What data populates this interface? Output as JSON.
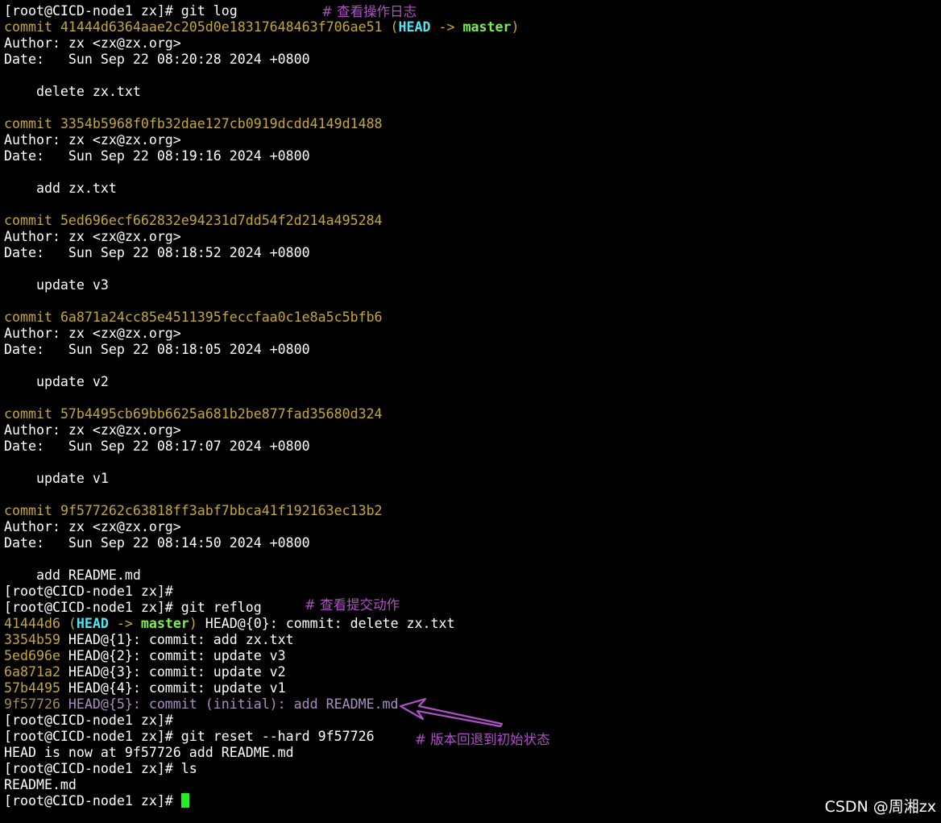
{
  "prompt": "[root@CICD-node1 zx]# ",
  "annotations": {
    "git_log": "# 查看操作日志",
    "git_reflog": "# 查看提交动作",
    "reset": "# 版本回退到初始状态"
  },
  "log": {
    "command": "git log",
    "commits": [
      {
        "word": "commit ",
        "hash": "41444d6364aae2c205d0e18317648463f706ae51",
        "author": "Author: zx <zx@zx.org>",
        "date": "Date:   Sun Sep 22 08:20:28 2024 +0800",
        "message": "    delete zx.txt"
      },
      {
        "word": "commit ",
        "hash": "3354b5968f0fb32dae127cb0919dcdd4149d1488",
        "author": "Author: zx <zx@zx.org>",
        "date": "Date:   Sun Sep 22 08:19:16 2024 +0800",
        "message": "    add zx.txt"
      },
      {
        "word": "commit ",
        "hash": "5ed696ecf662832e94231d7dd54f2d214a495284",
        "author": "Author: zx <zx@zx.org>",
        "date": "Date:   Sun Sep 22 08:18:52 2024 +0800",
        "message": "    update v3"
      },
      {
        "word": "commit ",
        "hash": "6a871a24cc85e4511395feccfaa0c1e8a5c5bfb6",
        "author": "Author: zx <zx@zx.org>",
        "date": "Date:   Sun Sep 22 08:18:05 2024 +0800",
        "message": "    update v2"
      },
      {
        "word": "commit ",
        "hash": "57b4495cb69bb6625a681b2be877fad35680d324",
        "author": "Author: zx <zx@zx.org>",
        "date": "Date:   Sun Sep 22 08:17:07 2024 +0800",
        "message": "    update v1"
      },
      {
        "word": "commit ",
        "hash": "9f577262c63818ff3abf7bbca41f192163ec13b2",
        "author": "Author: zx <zx@zx.org>",
        "date": "Date:   Sun Sep 22 08:14:50 2024 +0800",
        "message": "    add README.md"
      }
    ],
    "ref_open": " (",
    "ref_head": "HEAD",
    "ref_arrow": " -> ",
    "ref_master": "master",
    "ref_close": ")"
  },
  "reflog": {
    "command": "git reflog",
    "first": {
      "hash": "41444d6",
      "open": " (",
      "head": "HEAD",
      "arrow": " -> ",
      "master": "master",
      "close": ")",
      "rest": " HEAD@{0}: commit: delete zx.txt"
    },
    "entries": [
      {
        "hash": "3354b59",
        "rest": " HEAD@{1}: commit: add zx.txt"
      },
      {
        "hash": "5ed696e",
        "rest": " HEAD@{2}: commit: update v3"
      },
      {
        "hash": "6a871a2",
        "rest": " HEAD@{3}: commit: update v2"
      },
      {
        "hash": "57b4495",
        "rest": " HEAD@{4}: commit: update v1"
      },
      {
        "hash": "9f57726",
        "rest": " HEAD@{5}: commit (initial): add README.md"
      }
    ]
  },
  "reset": {
    "command": "git reset --hard 9f57726",
    "output": "HEAD is now at 9f57726 add README.md"
  },
  "ls": {
    "command": "ls",
    "output": "README.md"
  },
  "watermark": "CSDN @周湘zx",
  "colors": {
    "background": "#000000",
    "hash": "#c6a830",
    "head": "#4fe6f4",
    "branch": "#7cf04a",
    "annotation": "#b050c8",
    "cursor": "#22f022"
  }
}
